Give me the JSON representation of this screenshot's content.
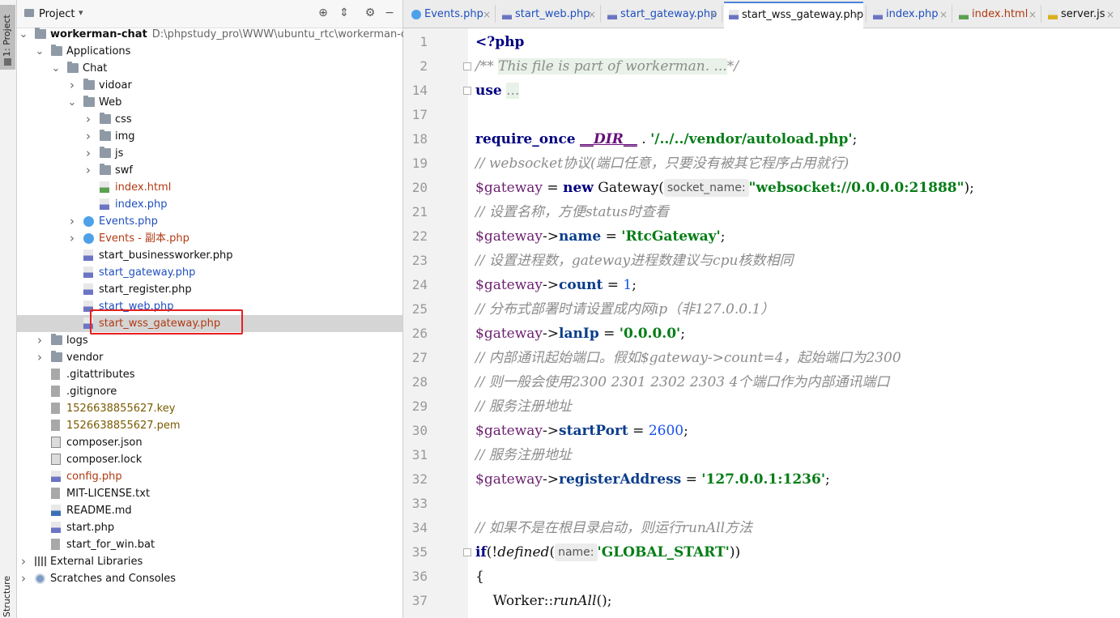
{
  "strip": {
    "project_tab": "1: Project",
    "structure_tab": "Structure"
  },
  "project_panel": {
    "title": "Project",
    "dropdown_glyph": "▾",
    "header_icons": [
      "locate-icon",
      "collapse-icon",
      "gear-icon",
      "hide-icon"
    ],
    "tree": [
      {
        "indent": 0,
        "arrow": "open",
        "icon": "folder",
        "label": "workerman-chat",
        "bold": true,
        "path": "D:\\phpstudy_pro\\WWW\\ubuntu_rtc\\workerman-chat"
      },
      {
        "indent": 1,
        "arrow": "open",
        "icon": "folder",
        "label": "Applications"
      },
      {
        "indent": 2,
        "arrow": "open",
        "icon": "folder",
        "label": "Chat"
      },
      {
        "indent": 3,
        "arrow": "closed",
        "icon": "folder",
        "label": "vidoar"
      },
      {
        "indent": 3,
        "arrow": "open",
        "icon": "folder",
        "label": "Web"
      },
      {
        "indent": 4,
        "arrow": "closed",
        "icon": "folder",
        "label": "css"
      },
      {
        "indent": 4,
        "arrow": "closed",
        "icon": "folder",
        "label": "img"
      },
      {
        "indent": 4,
        "arrow": "closed",
        "icon": "folder",
        "label": "js"
      },
      {
        "indent": 4,
        "arrow": "closed",
        "icon": "folder",
        "label": "swf"
      },
      {
        "indent": 4,
        "arrow": "none",
        "icon": "html",
        "label": "index.html",
        "color": "red"
      },
      {
        "indent": 4,
        "arrow": "none",
        "icon": "php",
        "label": "index.php",
        "color": "blue"
      },
      {
        "indent": 3,
        "arrow": "closed",
        "icon": "class",
        "label": "Events.php",
        "color": "blue"
      },
      {
        "indent": 3,
        "arrow": "closed",
        "icon": "class",
        "label": "Events - 副本.php",
        "color": "red"
      },
      {
        "indent": 3,
        "arrow": "none",
        "icon": "php",
        "label": "start_businessworker.php"
      },
      {
        "indent": 3,
        "arrow": "none",
        "icon": "php",
        "label": "start_gateway.php",
        "color": "blue"
      },
      {
        "indent": 3,
        "arrow": "none",
        "icon": "php",
        "label": "start_register.php"
      },
      {
        "indent": 3,
        "arrow": "none",
        "icon": "php",
        "label": "start_web.php",
        "color": "blue"
      },
      {
        "indent": 3,
        "arrow": "none",
        "icon": "php",
        "label": "start_wss_gateway.php",
        "color": "red",
        "selected": true
      },
      {
        "indent": 1,
        "arrow": "closed",
        "icon": "folder",
        "label": "logs"
      },
      {
        "indent": 1,
        "arrow": "closed",
        "icon": "folder",
        "label": "vendor"
      },
      {
        "indent": 1,
        "arrow": "none",
        "icon": "file",
        "label": ".gitattributes"
      },
      {
        "indent": 1,
        "arrow": "none",
        "icon": "file",
        "label": ".gitignore"
      },
      {
        "indent": 1,
        "arrow": "none",
        "icon": "file",
        "label": "1526638855627.key",
        "color": "olive"
      },
      {
        "indent": 1,
        "arrow": "none",
        "icon": "file",
        "label": "1526638855627.pem",
        "color": "olive"
      },
      {
        "indent": 1,
        "arrow": "none",
        "icon": "json",
        "label": "composer.json"
      },
      {
        "indent": 1,
        "arrow": "none",
        "icon": "json",
        "label": "composer.lock"
      },
      {
        "indent": 1,
        "arrow": "none",
        "icon": "php",
        "label": "config.php",
        "color": "red"
      },
      {
        "indent": 1,
        "arrow": "none",
        "icon": "file",
        "label": "MIT-LICENSE.txt"
      },
      {
        "indent": 1,
        "arrow": "none",
        "icon": "md",
        "label": "README.md"
      },
      {
        "indent": 1,
        "arrow": "none",
        "icon": "php",
        "label": "start.php"
      },
      {
        "indent": 1,
        "arrow": "none",
        "icon": "file",
        "label": "start_for_win.bat"
      },
      {
        "indent": 0,
        "arrow": "closed",
        "icon": "lib",
        "label": "External Libraries"
      },
      {
        "indent": 0,
        "arrow": "closed",
        "icon": "scratch",
        "label": "Scratches and Consoles"
      }
    ]
  },
  "tabs": [
    {
      "label": "Events.php",
      "icon": "class",
      "active": false,
      "color": "blue"
    },
    {
      "label": "start_web.php",
      "icon": "php",
      "active": false,
      "color": "blue"
    },
    {
      "label": "start_gateway.php",
      "icon": "php",
      "active": false,
      "color": "blue"
    },
    {
      "label": "start_wss_gateway.php",
      "icon": "php",
      "active": true,
      "color": "black"
    },
    {
      "label": "index.php",
      "icon": "php",
      "active": false,
      "color": "blue"
    },
    {
      "label": "index.html",
      "icon": "html",
      "active": false,
      "color": "red"
    },
    {
      "label": "server.js",
      "icon": "js",
      "active": false,
      "color": "black"
    }
  ],
  "code_lines": [
    {
      "n": "1",
      "tokens": [
        [
          "kw",
          "<?php"
        ]
      ]
    },
    {
      "n": "2",
      "fold": true,
      "tokens": [
        [
          "cm",
          "/** "
        ],
        [
          "cmbox",
          "This file is part of workerman. ..."
        ],
        [
          "cm",
          "*/"
        ]
      ]
    },
    {
      "n": "14",
      "fold": true,
      "tokens": [
        [
          "kw",
          "use"
        ],
        [
          "t",
          " "
        ],
        [
          "cmbox",
          "..."
        ]
      ]
    },
    {
      "n": "17",
      "tokens": []
    },
    {
      "n": "18",
      "tokens": [
        [
          "kw",
          "require_once"
        ],
        [
          "t",
          " "
        ],
        [
          "const",
          "__DIR__"
        ],
        [
          "t",
          " . "
        ],
        [
          "str",
          "'/../../vendor/autoload.php'"
        ],
        [
          "t",
          ";"
        ]
      ]
    },
    {
      "n": "19",
      "tokens": [
        [
          "cm",
          "// websocket协议(端口任意，只要没有被其它程序占用就行)"
        ]
      ]
    },
    {
      "n": "20",
      "tokens": [
        [
          "var",
          "$gateway"
        ],
        [
          "t",
          " = "
        ],
        [
          "kw",
          "new"
        ],
        [
          "t",
          " Gateway("
        ],
        [
          "hint",
          "socket_name:"
        ],
        [
          "str",
          "\"websocket://0.0.0.0:21888\""
        ],
        [
          "t",
          ");"
        ]
      ]
    },
    {
      "n": "21",
      "tokens": [
        [
          "cm",
          "// 设置名称，方便status时查看"
        ]
      ]
    },
    {
      "n": "22",
      "tokens": [
        [
          "var",
          "$gateway"
        ],
        [
          "t",
          "->"
        ],
        [
          "prop",
          "name"
        ],
        [
          "t",
          " = "
        ],
        [
          "str",
          "'RtcGateway'"
        ],
        [
          "t",
          ";"
        ]
      ]
    },
    {
      "n": "23",
      "tokens": [
        [
          "cm",
          "// 设置进程数，gateway进程数建议与cpu核数相同"
        ]
      ]
    },
    {
      "n": "24",
      "tokens": [
        [
          "var",
          "$gateway"
        ],
        [
          "t",
          "->"
        ],
        [
          "prop",
          "count"
        ],
        [
          "t",
          " = "
        ],
        [
          "num",
          "1"
        ],
        [
          "t",
          ";"
        ]
      ]
    },
    {
      "n": "25",
      "tokens": [
        [
          "cm",
          "// 分布式部署时请设置成内网ip（非127.0.0.1）"
        ]
      ]
    },
    {
      "n": "26",
      "tokens": [
        [
          "var",
          "$gateway"
        ],
        [
          "t",
          "->"
        ],
        [
          "prop",
          "lanIp"
        ],
        [
          "t",
          " = "
        ],
        [
          "str",
          "'0.0.0.0'"
        ],
        [
          "t",
          ";"
        ]
      ]
    },
    {
      "n": "27",
      "tokens": [
        [
          "cm",
          "// 内部通讯起始端口。假如$gateway->count=4，起始端口为2300"
        ]
      ]
    },
    {
      "n": "28",
      "tokens": [
        [
          "cm",
          "// 则一般会使用2300 2301 2302 2303 4个端口作为内部通讯端口"
        ]
      ]
    },
    {
      "n": "29",
      "tokens": [
        [
          "cm",
          "// 服务注册地址"
        ]
      ]
    },
    {
      "n": "30",
      "tokens": [
        [
          "var",
          "$gateway"
        ],
        [
          "t",
          "->"
        ],
        [
          "prop",
          "startPort"
        ],
        [
          "t",
          " = "
        ],
        [
          "num",
          "2600"
        ],
        [
          "t",
          ";"
        ]
      ]
    },
    {
      "n": "31",
      "tokens": [
        [
          "cm",
          "// 服务注册地址"
        ]
      ]
    },
    {
      "n": "32",
      "tokens": [
        [
          "var",
          "$gateway"
        ],
        [
          "t",
          "->"
        ],
        [
          "prop",
          "registerAddress"
        ],
        [
          "t",
          " = "
        ],
        [
          "str",
          "'127.0.0.1:1236'"
        ],
        [
          "t",
          ";"
        ]
      ]
    },
    {
      "n": "33",
      "tokens": []
    },
    {
      "n": "34",
      "tokens": [
        [
          "cm",
          "// 如果不是在根目录启动，则运行runAll方法"
        ]
      ]
    },
    {
      "n": "35",
      "fold": true,
      "tokens": [
        [
          "kw",
          "if"
        ],
        [
          "t",
          "(!"
        ],
        [
          "fn",
          "defined"
        ],
        [
          "t",
          "("
        ],
        [
          "hint",
          "name:"
        ],
        [
          "str",
          "'GLOBAL_START'"
        ],
        [
          "t",
          "))"
        ]
      ]
    },
    {
      "n": "36",
      "tokens": [
        [
          "t",
          "{"
        ]
      ]
    },
    {
      "n": "37",
      "tokens": [
        [
          "t",
          "    Worker::"
        ],
        [
          "fn",
          "runAll"
        ],
        [
          "t",
          "();"
        ]
      ]
    }
  ]
}
